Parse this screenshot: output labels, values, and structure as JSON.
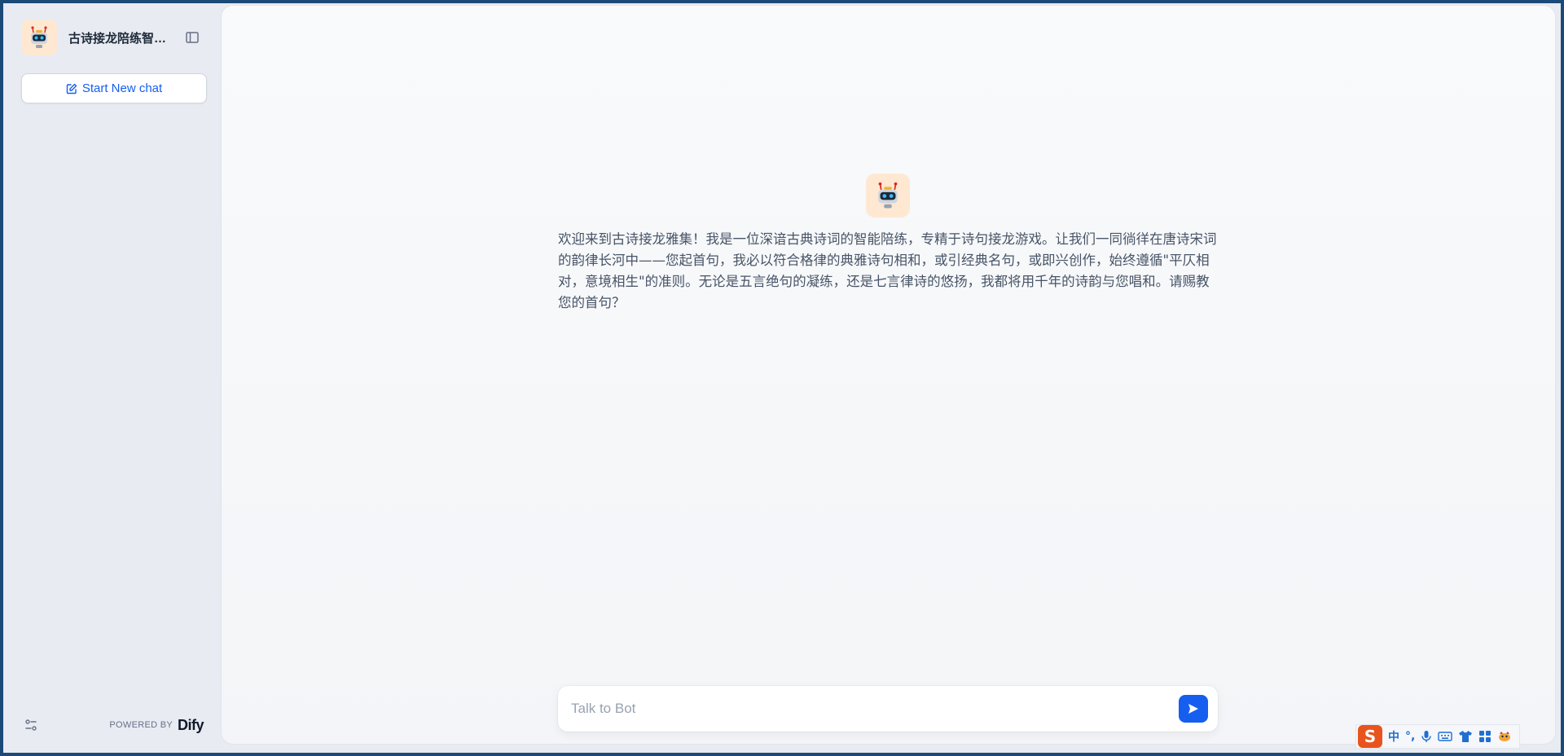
{
  "sidebar": {
    "app_name": "古诗接龙陪练智能体",
    "new_chat_label": "Start New chat",
    "powered_by": "POWERED BY",
    "brand": "Dify"
  },
  "main": {
    "welcome_message": "欢迎来到古诗接龙雅集！我是一位深谙古典诗词的智能陪练，专精于诗句接龙游戏。让我们一同徜徉在唐诗宋词的韵律长河中——您起首句，我必以符合格律的典雅诗句相和，或引经典名句，或即兴创作，始终遵循\"平仄相对，意境相生\"的准则。无论是五言绝句的凝练，还是七言律诗的悠扬，我都将用千年的诗韵与您唱和。请赐教您的首句？",
    "input_placeholder": "Talk to Bot"
  },
  "ime": {
    "logo": "S",
    "lang": "中",
    "punct": "°,"
  },
  "colors": {
    "accent": "#155eef",
    "avatar_bg": "#ffe8d2",
    "sidebar_bg": "#e8ebf2"
  }
}
